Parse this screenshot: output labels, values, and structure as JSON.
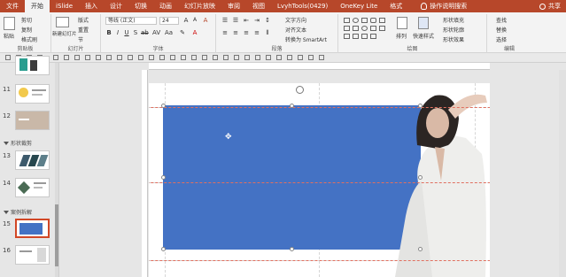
{
  "tabs": [
    "文件",
    "开始",
    "iSlide",
    "插入",
    "设计",
    "切换",
    "动画",
    "幻灯片放映",
    "审阅",
    "视图",
    "LvyhTools(0429)",
    "OneKey Lite",
    "格式"
  ],
  "active_tab": "开始",
  "tell_me": "操作说明搜索",
  "share": "共享",
  "ribbon": {
    "clipboard": {
      "paste": "粘贴",
      "cut": "剪切",
      "copy": "复制",
      "format_painter": "格式刷",
      "label": "剪贴板"
    },
    "slides": {
      "new_slide": "新建幻灯片",
      "layout": "版式",
      "reset": "重置",
      "section": "节",
      "label": "幻灯片"
    },
    "font": {
      "font_name": "等线 (正文)",
      "font_size": "24",
      "label": "字体"
    },
    "paragraph": {
      "text_direction": "文字方向",
      "align_text": "对齐文本",
      "smartart": "转换为 SmartArt",
      "label": "段落"
    },
    "drawing": {
      "arrange": "排列",
      "quick_styles": "快速样式",
      "shape_fill": "形状填充",
      "shape_outline": "形状轮廓",
      "shape_effects": "形状效果",
      "label": "绘图"
    },
    "editing": {
      "find": "查找",
      "replace": "替换",
      "select": "选择",
      "label": "编辑"
    }
  },
  "slides_panel": {
    "items": [
      {
        "number": "11"
      },
      {
        "number": "12"
      },
      {
        "section": "形状裁剪"
      },
      {
        "number": "13"
      },
      {
        "number": "14"
      },
      {
        "section": "案例拆解"
      },
      {
        "number": "15",
        "selected": true
      },
      {
        "number": "16"
      }
    ]
  },
  "colors": {
    "accent": "#b7472a",
    "shape_fill": "#4472c4"
  }
}
